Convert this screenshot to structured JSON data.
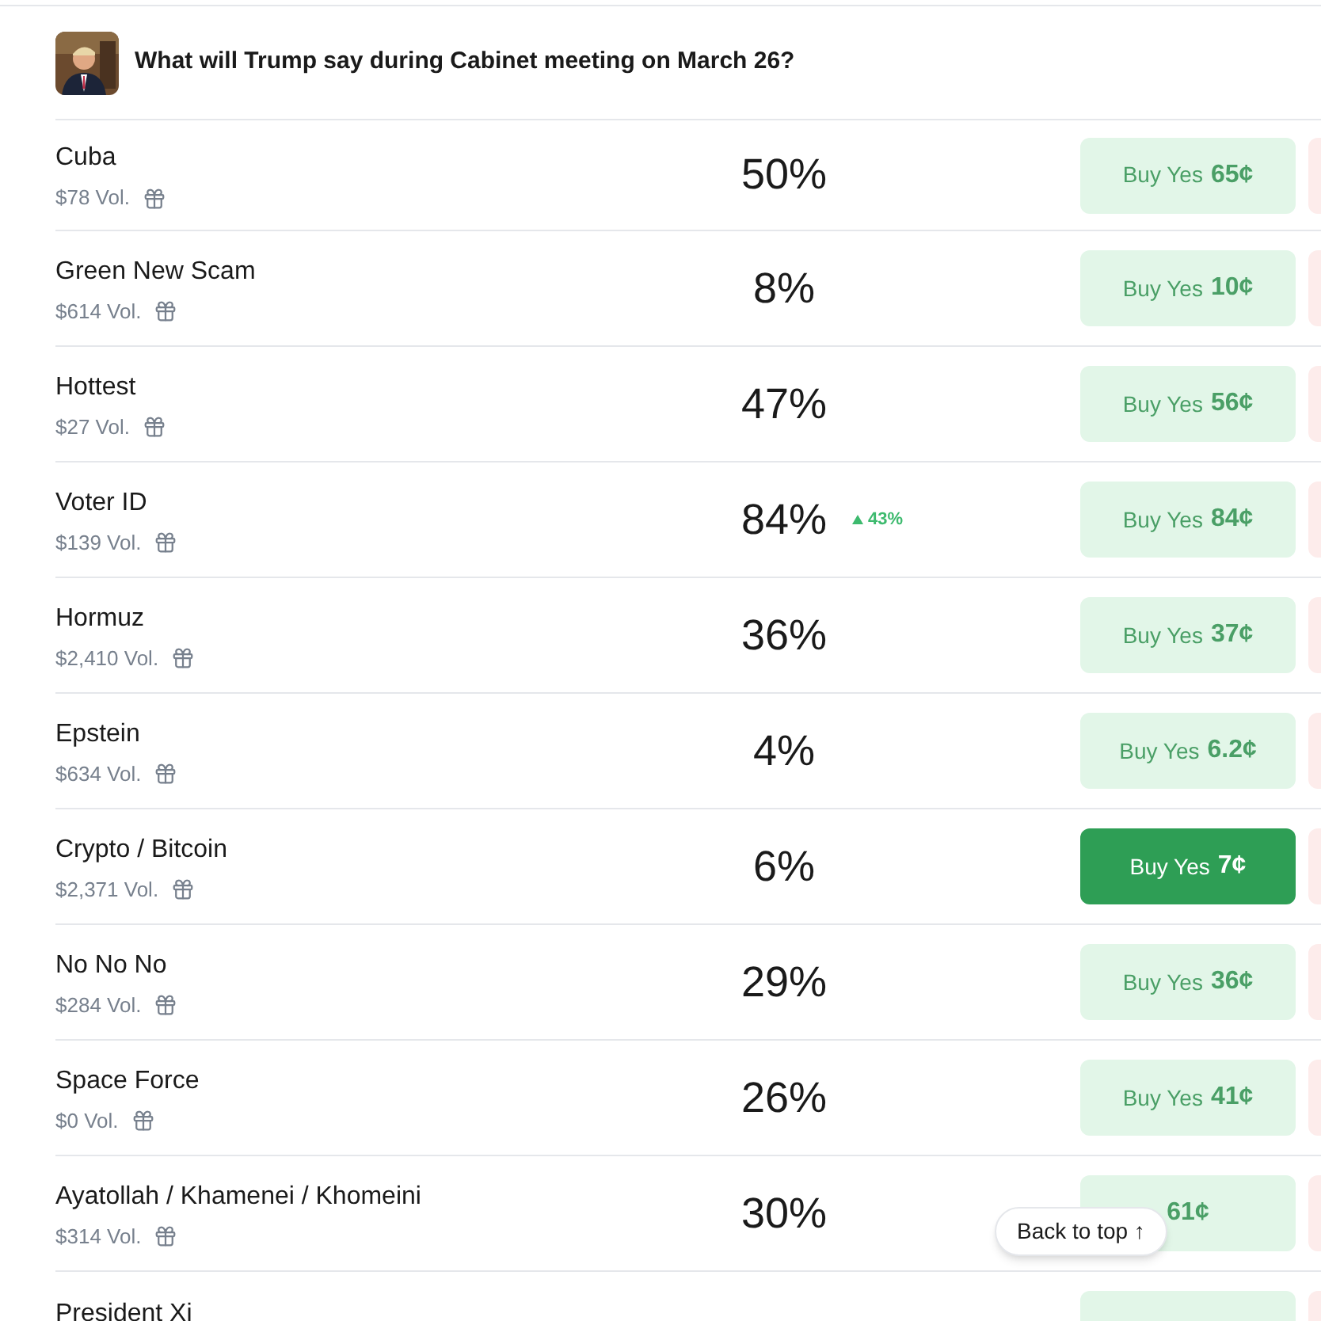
{
  "market": {
    "title": "What will Trump say during Cabinet meeting on March 26?"
  },
  "outcomes": [
    {
      "name": "Cuba",
      "volume": "$78 Vol.",
      "chance": "50%",
      "yes_label": "Buy Yes",
      "yes_price": "65¢",
      "selected": false
    },
    {
      "name": "Green New Scam",
      "volume": "$614 Vol.",
      "chance": "8%",
      "yes_label": "Buy Yes",
      "yes_price": "10¢",
      "selected": false
    },
    {
      "name": "Hottest",
      "volume": "$27 Vol.",
      "chance": "47%",
      "yes_label": "Buy Yes",
      "yes_price": "56¢",
      "selected": false
    },
    {
      "name": "Voter ID",
      "volume": "$139 Vol.",
      "chance": "84%",
      "change": "43%",
      "yes_label": "Buy Yes",
      "yes_price": "84¢",
      "selected": false
    },
    {
      "name": "Hormuz",
      "volume": "$2,410 Vol.",
      "chance": "36%",
      "yes_label": "Buy Yes",
      "yes_price": "37¢",
      "selected": false
    },
    {
      "name": "Epstein",
      "volume": "$634 Vol.",
      "chance": "4%",
      "yes_label": "Buy Yes",
      "yes_price": "6.2¢",
      "selected": false
    },
    {
      "name": "Crypto / Bitcoin",
      "volume": "$2,371 Vol.",
      "chance": "6%",
      "yes_label": "Buy Yes",
      "yes_price": "7¢",
      "selected": true
    },
    {
      "name": "No No No",
      "volume": "$284 Vol.",
      "chance": "29%",
      "yes_label": "Buy Yes",
      "yes_price": "36¢",
      "selected": false
    },
    {
      "name": "Space Force",
      "volume": "$0 Vol.",
      "chance": "26%",
      "yes_label": "Buy Yes",
      "yes_price": "41¢",
      "selected": false
    },
    {
      "name": "Ayatollah / Khamenei / Khomeini",
      "volume": "$314 Vol.",
      "chance": "30%",
      "yes_price": "61¢",
      "selected": false
    },
    {
      "name": "President Xi",
      "selected": false
    }
  ],
  "back_to_top": {
    "label": "Back to top ↑"
  }
}
